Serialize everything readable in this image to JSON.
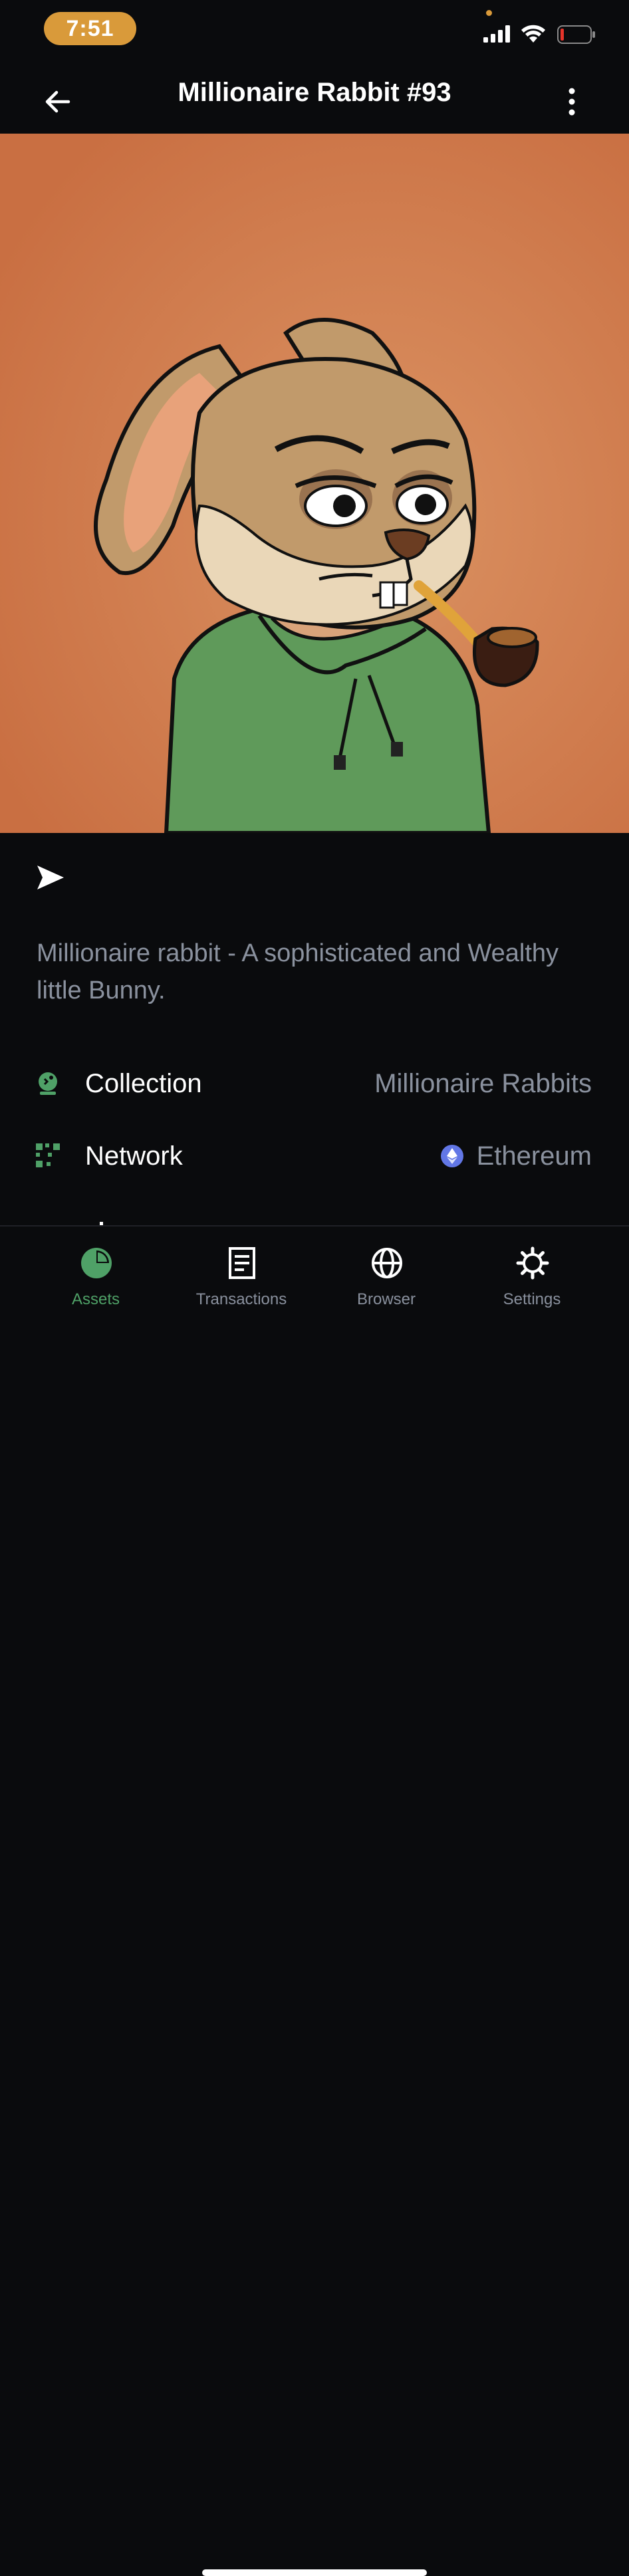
{
  "status_bar": {
    "time": "7:51"
  },
  "header": {
    "title": "Millionaire Rabbit #93"
  },
  "nft": {
    "description": "Millionaire rabbit - A sophisticated and Wealthy little Bunny.",
    "background_color": "#c96f42"
  },
  "details": [
    {
      "label": "Collection",
      "value": "Millionaire Rabbits",
      "icon": "collection-icon"
    },
    {
      "label": "Network",
      "value": "Ethereum",
      "icon": "network-icon"
    }
  ],
  "tabs": [
    {
      "label": "Assets",
      "icon": "pie-chart-icon",
      "active": true
    },
    {
      "label": "Transactions",
      "icon": "document-icon",
      "active": false
    },
    {
      "label": "Browser",
      "icon": "globe-icon",
      "active": false
    },
    {
      "label": "Settings",
      "icon": "gear-icon",
      "active": false
    }
  ],
  "colors": {
    "accent": "#4fa167",
    "muted_text": "#8a919e",
    "background": "#0a0b0d",
    "status_pill": "#d99a3a",
    "ethereum": "#6277e6"
  }
}
